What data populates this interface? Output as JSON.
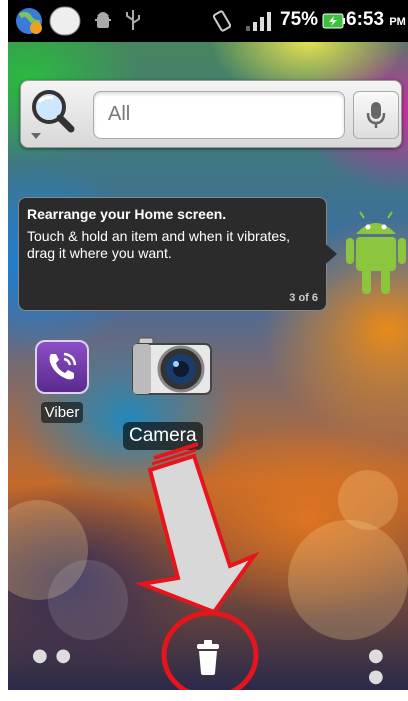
{
  "status_bar": {
    "battery_percent": "75%",
    "time": "6:53",
    "time_suffix": "PM",
    "icons": [
      "browser-globe-icon",
      "notification-blank-icon",
      "android-debug-icon",
      "usb-icon",
      "vibrate-icon",
      "signal-icon",
      "battery-charging-icon"
    ]
  },
  "search_widget": {
    "placeholder": "All",
    "icons": [
      "search-magnifier-icon",
      "microphone-icon"
    ]
  },
  "tooltip": {
    "title": "Rearrange your Home screen.",
    "body": "Touch & hold an item and when it vibrates, drag it where you want.",
    "counter": "3 of 6"
  },
  "apps": [
    {
      "label": "Viber",
      "icon": "viber-phone-icon"
    },
    {
      "label": "Camera",
      "icon": "camera-icon"
    }
  ],
  "dock": {
    "icons": [
      "page-dots-left-icon",
      "trash-icon",
      "page-dots-right-icon"
    ]
  },
  "annotation": {
    "arrow_color": "#e8141c",
    "circle_color": "#e8141c"
  }
}
